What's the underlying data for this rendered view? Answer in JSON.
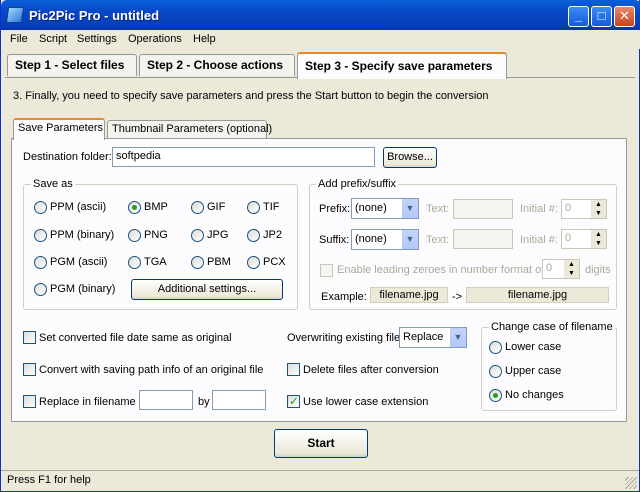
{
  "window": {
    "title": "Pic2Pic Pro - untitled"
  },
  "menu": [
    "File",
    "Script",
    "Settings",
    "Operations",
    "Help"
  ],
  "steps": [
    "Step 1 - Select files",
    "Step 2 - Choose actions",
    "Step 3 - Specify save parameters"
  ],
  "instruction": "3. Finally, you need to specify save parameters and press the Start button to begin the conversion",
  "subtabs": [
    "Save Parameters",
    "Thumbnail Parameters (optional)"
  ],
  "destination": {
    "label": "Destination folder:",
    "value": "softpedia",
    "browse": "Browse..."
  },
  "save_as": {
    "label": "Save as",
    "formats": [
      "PPM (ascii)",
      "BMP",
      "GIF",
      "TIF",
      "PPM (binary)",
      "PNG",
      "JPG",
      "JP2",
      "PGM (ascii)",
      "TGA",
      "PBM",
      "PCX",
      "PGM (binary)"
    ],
    "selected": "BMP",
    "additional": "Additional settings..."
  },
  "prefix_suffix": {
    "label": "Add prefix/suffix",
    "prefix_label": "Prefix:",
    "prefix_value": "(none)",
    "suffix_label": "Suffix:",
    "suffix_value": "(none)",
    "text_label": "Text:",
    "initial_label": "Initial #:",
    "initial_value": "0",
    "leading_zeroes": "Enable leading zeroes in number format of",
    "digits_value": "0",
    "digits_label": "digits",
    "example_label": "Example:",
    "example_src": "filename.jpg",
    "arrow": "->",
    "example_dst": "filename.jpg"
  },
  "options": {
    "set_date": "Set converted file date same as original",
    "convert_path": "Convert with saving path info of an original file",
    "replace_in_filename": "Replace in filename",
    "by_label": "by",
    "overwriting_label": "Overwriting existing file",
    "overwriting_value": "Replace",
    "delete_files": "Delete files after conversion",
    "lower_ext": "Use lower case extension"
  },
  "change_case": {
    "label": "Change case of filename",
    "options": [
      "Lower case",
      "Upper case",
      "No changes"
    ],
    "selected": "No changes"
  },
  "start_label": "Start",
  "status": "Press F1 for help"
}
